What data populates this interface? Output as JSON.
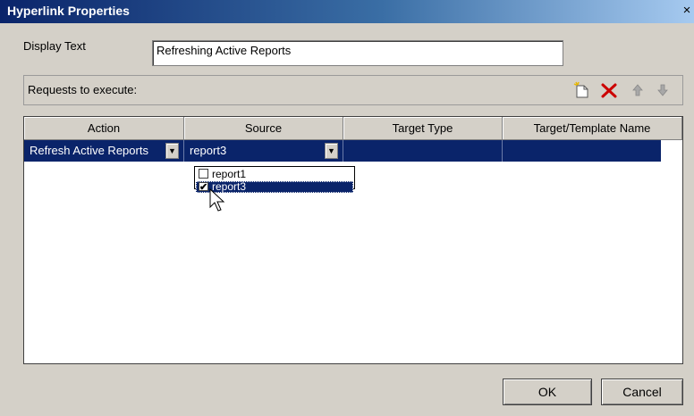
{
  "window": {
    "title": "Hyperlink Properties",
    "close_glyph": "×"
  },
  "display_text": {
    "label": "Display Text",
    "value": "Refreshing Active Reports"
  },
  "requests": {
    "label": "Requests to execute:",
    "toolbar_icons": [
      "new-request-icon",
      "delete-icon",
      "move-up-icon",
      "move-down-icon"
    ]
  },
  "grid": {
    "columns": [
      "Action",
      "Source",
      "Target Type",
      "Target/Template Name"
    ],
    "rows": [
      {
        "action": "Refresh Active Reports",
        "source": "report3",
        "target_type": "",
        "target_name": ""
      }
    ]
  },
  "source_dropdown": {
    "options": [
      {
        "label": "report1",
        "checked": false,
        "check_glyph": ""
      },
      {
        "label": "report3",
        "checked": true,
        "check_glyph": "✔"
      }
    ]
  },
  "buttons": {
    "ok": "OK",
    "cancel": "Cancel"
  },
  "colors": {
    "selection": "#0a246a",
    "dialog_bg": "#d4d0c8",
    "delete_icon": "#cc0000"
  }
}
